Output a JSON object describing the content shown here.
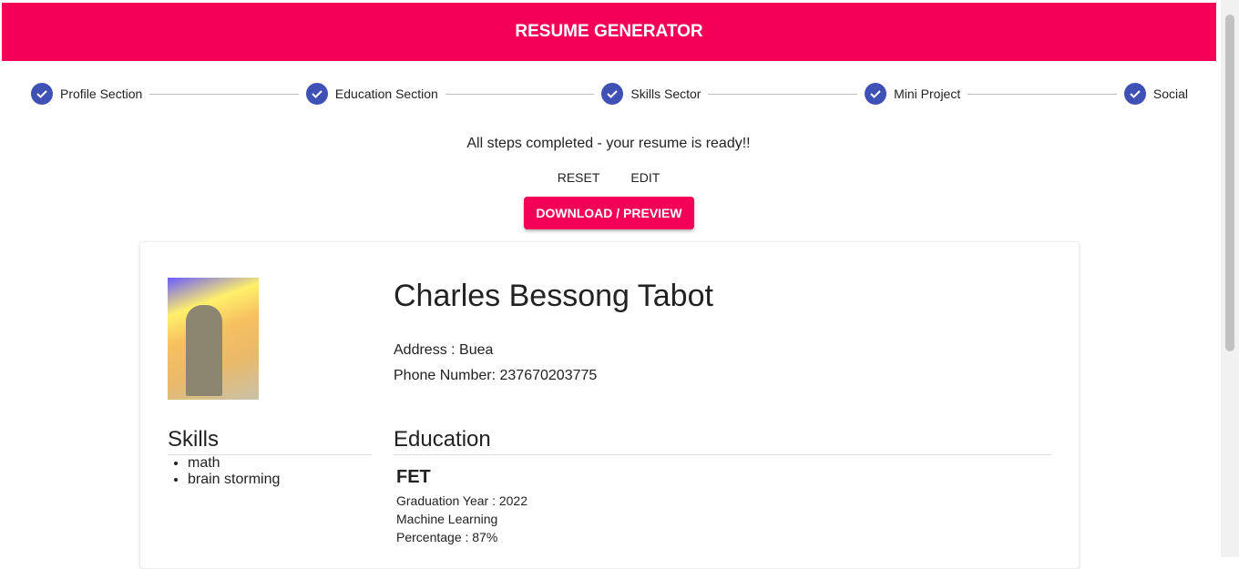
{
  "header": {
    "title": "RESUME GENERATOR"
  },
  "stepper": {
    "steps": [
      "Profile Section",
      "Education Section",
      "Skills Sector",
      "Mini Project",
      "Social"
    ]
  },
  "status": {
    "message": "All steps completed - your resume is ready!!"
  },
  "actions": {
    "reset": "RESET",
    "edit": "EDIT",
    "download": "DOWNLOAD / PREVIEW"
  },
  "colors": {
    "primary": "#f50057",
    "step": "#3f51b5"
  },
  "resume": {
    "name": "Charles Bessong Tabot",
    "address": "Address : Buea",
    "phone": "Phone Number: 237670203775",
    "skills_title": "Skills",
    "skills": [
      "math",
      "brain storming"
    ],
    "education_title": "Education",
    "education": {
      "school": "FET",
      "year": "Graduation Year : 2022",
      "field": "Machine Learning",
      "percentage": "Percentage : 87%"
    }
  }
}
